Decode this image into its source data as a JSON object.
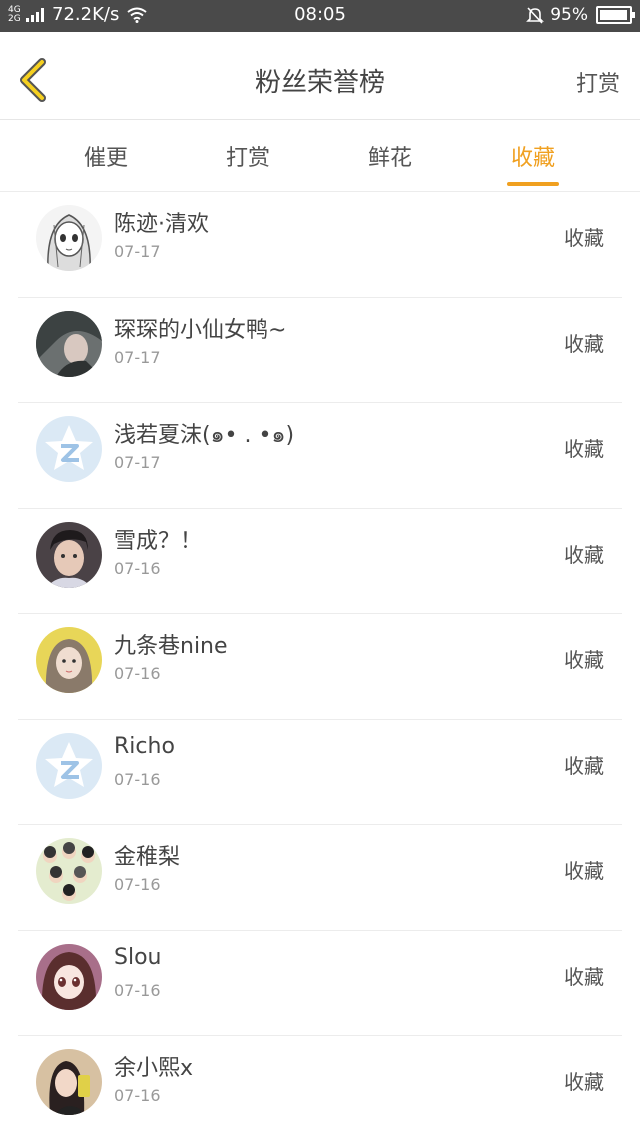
{
  "status_bar": {
    "network": "4G 2G",
    "speed": "72.2K/s",
    "time": "08:05",
    "battery": "95%",
    "battery_level": 0.95
  },
  "header": {
    "title": "粉丝荣誉榜",
    "right_link": "打赏"
  },
  "tabs": [
    {
      "label": "催更"
    },
    {
      "label": "打赏"
    },
    {
      "label": "鲜花"
    },
    {
      "label": "收藏",
      "active": true
    }
  ],
  "colors": {
    "accent": "#f0a020",
    "status_bar": "#4a4a4a"
  },
  "list": [
    {
      "name": "陈迹·清欢",
      "date": "07-17",
      "action": "收藏",
      "avatar": "sketch"
    },
    {
      "name": "琛琛的小仙女鸭~",
      "date": "07-17",
      "action": "收藏",
      "avatar": "photo-dark"
    },
    {
      "name": "浅若夏沫(๑• . •๑)",
      "date": "07-17",
      "action": "收藏",
      "avatar": "default"
    },
    {
      "name": "雪成？！",
      "date": "07-16",
      "action": "收藏",
      "avatar": "photo-boy"
    },
    {
      "name": "九条巷nine",
      "date": "07-16",
      "action": "收藏",
      "avatar": "photo-yellow"
    },
    {
      "name": "Richo",
      "date": "07-16",
      "action": "收藏",
      "avatar": "default"
    },
    {
      "name": "金稚梨",
      "date": "07-16",
      "action": "收藏",
      "avatar": "photo-group"
    },
    {
      "name": "Slou",
      "date": "07-16",
      "action": "收藏",
      "avatar": "anime"
    },
    {
      "name": "余小熙x",
      "date": "07-16",
      "action": "收藏",
      "avatar": "photo-selfie"
    }
  ]
}
